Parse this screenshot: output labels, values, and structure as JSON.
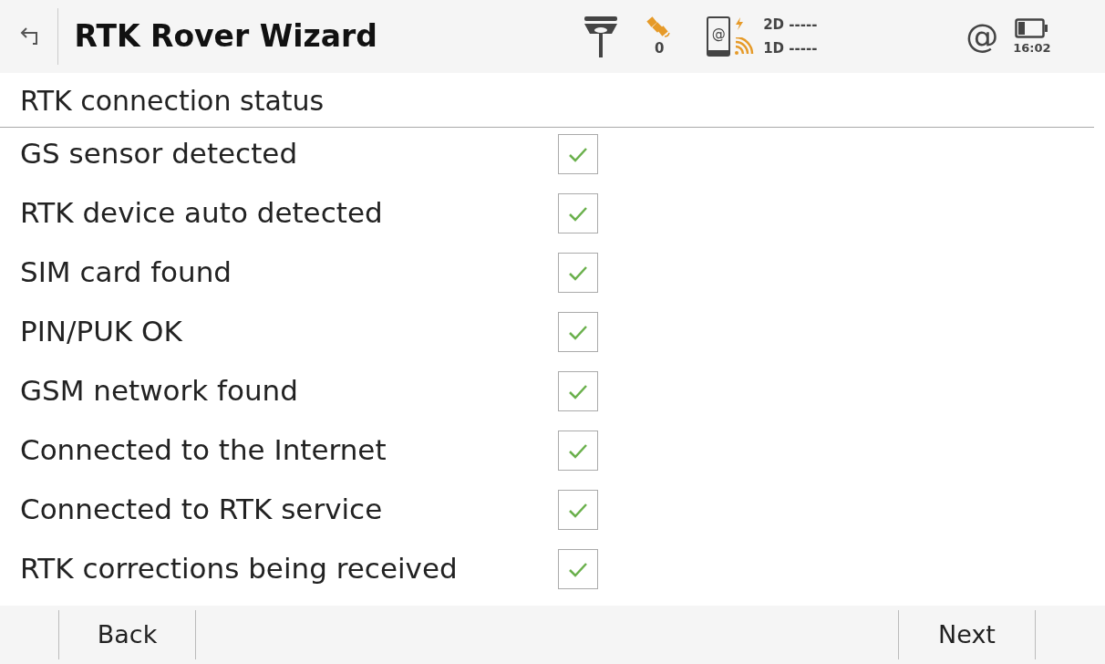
{
  "header": {
    "title": "RTK Rover Wizard",
    "satellites": "0",
    "phone_symbol": "@",
    "position_2d": "2D -----",
    "position_1d": "1D -----",
    "connection_symbol": "@",
    "time": "16:02"
  },
  "section_title": "RTK connection status",
  "checks": [
    {
      "label": "GS sensor detected",
      "checked": true
    },
    {
      "label": "RTK device auto detected",
      "checked": true
    },
    {
      "label": "SIM card found",
      "checked": true
    },
    {
      "label": "PIN/PUK OK",
      "checked": true
    },
    {
      "label": "GSM network found",
      "checked": true
    },
    {
      "label": "Connected to the Internet",
      "checked": true
    },
    {
      "label": "Connected to RTK service",
      "checked": true
    },
    {
      "label": "RTK corrections being received",
      "checked": true
    }
  ],
  "buttons": [
    "Back",
    "Next"
  ]
}
